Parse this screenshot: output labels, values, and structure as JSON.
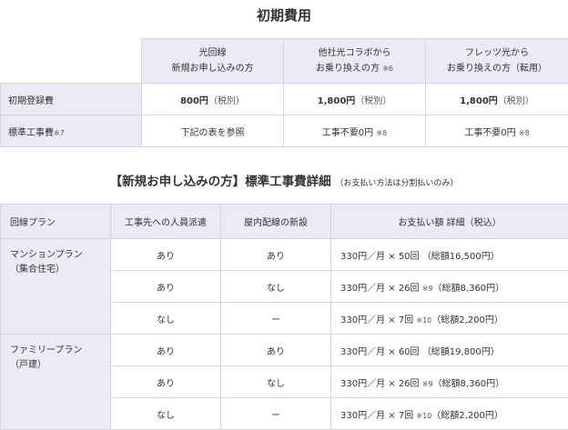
{
  "section1": {
    "title": "初期費用",
    "columns": [
      {
        "line1": "光回線",
        "line2": "新規お申し込みの方",
        "note": ""
      },
      {
        "line1": "他社光コラボから",
        "line2": "お乗り換えの方",
        "note": "※6"
      },
      {
        "line1": "フレッツ光から",
        "line2": "お乗り換えの方（転用）",
        "note": ""
      }
    ],
    "rows": [
      {
        "label": "初期登録費",
        "label_note": "",
        "cells": [
          {
            "main": "800円",
            "tax": "（税別）",
            "note": ""
          },
          {
            "main": "1,800円",
            "tax": "（税別）",
            "note": ""
          },
          {
            "main": "1,800円",
            "tax": "（税別）",
            "note": ""
          }
        ]
      },
      {
        "label": "標準工事費",
        "label_note": "※7",
        "cells": [
          {
            "main": "下記の表を参照",
            "tax": "",
            "note": ""
          },
          {
            "main": "工事不要0円",
            "tax": "",
            "note": "※8"
          },
          {
            "main": "工事不要0円",
            "tax": "",
            "note": "※8"
          }
        ]
      }
    ]
  },
  "section2": {
    "title": "【新規お申し込みの方】標準工事費詳細",
    "title_note": "（お支払い方法は分割払いのみ）",
    "headers": [
      "回線プラン",
      "工事先への人員派遣",
      "屋内配線の新設",
      "お支払い額 詳細（税込）"
    ],
    "plans": [
      {
        "name_line1": "マンションプラン",
        "name_line2": "（集合住宅）",
        "rows": [
          {
            "dispatch": "あり",
            "wiring": "あり",
            "pay": "330円／月 × 50回",
            "note": "",
            "total": "（総額16,500円）"
          },
          {
            "dispatch": "あり",
            "wiring": "なし",
            "pay": "330円／月 × 26回",
            "note": "※9",
            "total": "（総額8,360円）"
          },
          {
            "dispatch": "なし",
            "wiring": "ー",
            "pay": "330円／月 × 7回",
            "note": "※10",
            "total": "（総額2,200円）"
          }
        ]
      },
      {
        "name_line1": "ファミリープラン",
        "name_line2": "（戸建）",
        "rows": [
          {
            "dispatch": "あり",
            "wiring": "あり",
            "pay": "330円／月 × 60回",
            "note": "",
            "total": "（総額19,800円）"
          },
          {
            "dispatch": "あり",
            "wiring": "なし",
            "pay": "330円／月 × 26回",
            "note": "※9",
            "total": "（総額8,360円）"
          },
          {
            "dispatch": "なし",
            "wiring": "ー",
            "pay": "330円／月 × 7回",
            "note": "※10",
            "total": "（総額2,200円）"
          }
        ]
      }
    ]
  }
}
